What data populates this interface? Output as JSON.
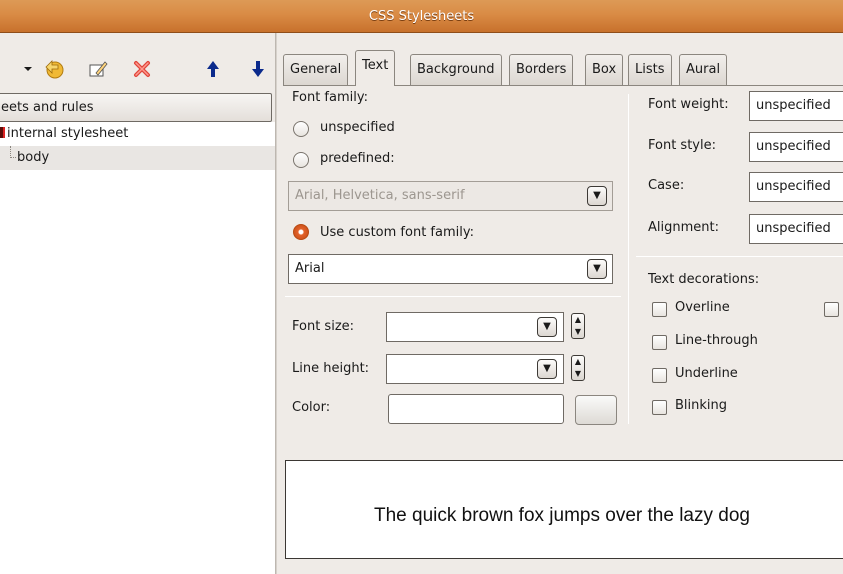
{
  "window": {
    "title": "CSS Stylesheets"
  },
  "toolbar": {
    "items": [
      {
        "icon": "chevron-down-icon"
      },
      {
        "icon": "new-stylesheet-icon"
      },
      {
        "icon": "edit-icon"
      },
      {
        "icon": "delete-icon"
      },
      {
        "icon": "arrow-up-icon"
      },
      {
        "icon": "arrow-down-icon"
      }
    ]
  },
  "tree": {
    "header": "eets and rules",
    "items": [
      {
        "label": "internal stylesheet"
      },
      {
        "label": "body"
      }
    ]
  },
  "tabs": [
    {
      "label": "General"
    },
    {
      "label": "Text"
    },
    {
      "label": "Background"
    },
    {
      "label": "Borders"
    },
    {
      "label": "Box"
    },
    {
      "label": "Lists"
    },
    {
      "label": "Aural"
    }
  ],
  "font_family": {
    "heading": "Font family:",
    "unspecified": "unspecified",
    "predefined": "predefined:",
    "predefined_value": "Arial, Helvetica, sans-serif",
    "custom": "Use custom font family:",
    "custom_value": "Arial"
  },
  "font_size": {
    "label": "Font size:",
    "value": ""
  },
  "line_height": {
    "label": "Line height:",
    "value": ""
  },
  "color": {
    "label": "Color:",
    "value": ""
  },
  "right": {
    "font_weight": {
      "label": "Font weight:",
      "value": "unspecified"
    },
    "font_style": {
      "label": "Font style:",
      "value": "unspecified"
    },
    "case": {
      "label": "Case:",
      "value": "unspecified"
    },
    "alignment": {
      "label": "Alignment:",
      "value": "unspecified"
    },
    "decorations_heading": "Text decorations:",
    "decorations": [
      {
        "label": "Overline"
      },
      {
        "label": "Line-through"
      },
      {
        "label": "Underline"
      },
      {
        "label": "Blinking"
      }
    ]
  },
  "preview": {
    "text": "The quick brown fox jumps over the lazy dog"
  },
  "colors": {
    "titlebar": "#d98b45",
    "radio_active": "#e3622a"
  }
}
